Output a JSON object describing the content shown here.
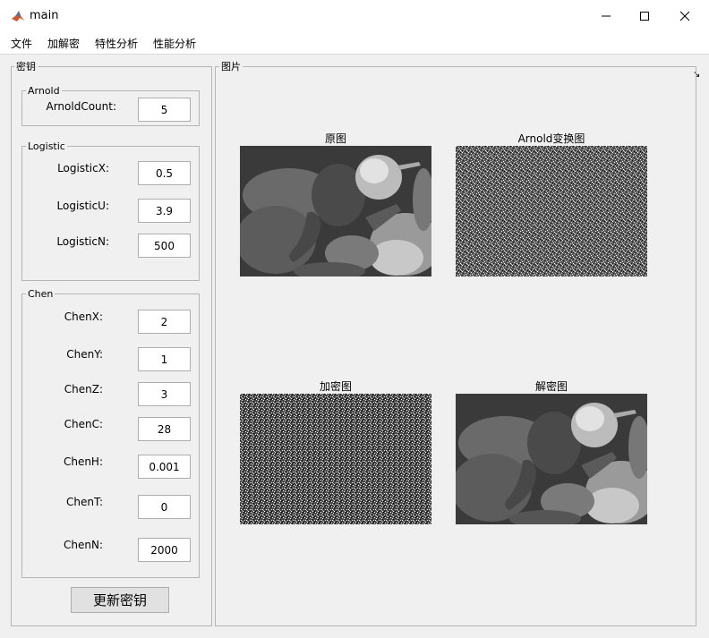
{
  "window": {
    "title": "main"
  },
  "menu": {
    "items": [
      "文件",
      "加解密",
      "特性分析",
      "性能分析"
    ]
  },
  "key_panel": {
    "title": "密钥",
    "arnold": {
      "title": "Arnold",
      "count_label": "ArnoldCount:",
      "count_value": "5"
    },
    "logistic": {
      "title": "Logistic",
      "x_label": "LogisticX:",
      "x_value": "0.5",
      "u_label": "LogisticU:",
      "u_value": "3.9",
      "n_label": "LogisticN:",
      "n_value": "500"
    },
    "chen": {
      "title": "Chen",
      "x_label": "ChenX:",
      "x_value": "2",
      "y_label": "ChenY:",
      "y_value": "1",
      "z_label": "ChenZ:",
      "z_value": "3",
      "c_label": "ChenC:",
      "c_value": "28",
      "h_label": "ChenH:",
      "h_value": "0.001",
      "t_label": "ChenT:",
      "t_value": "0",
      "n_label": "ChenN:",
      "n_value": "2000"
    },
    "update_button": "更新密钥"
  },
  "image_panel": {
    "title": "图片",
    "original_title": "原图",
    "arnold_title": "Arnold变换图",
    "encrypted_title": "加密图",
    "decrypted_title": "解密图"
  }
}
